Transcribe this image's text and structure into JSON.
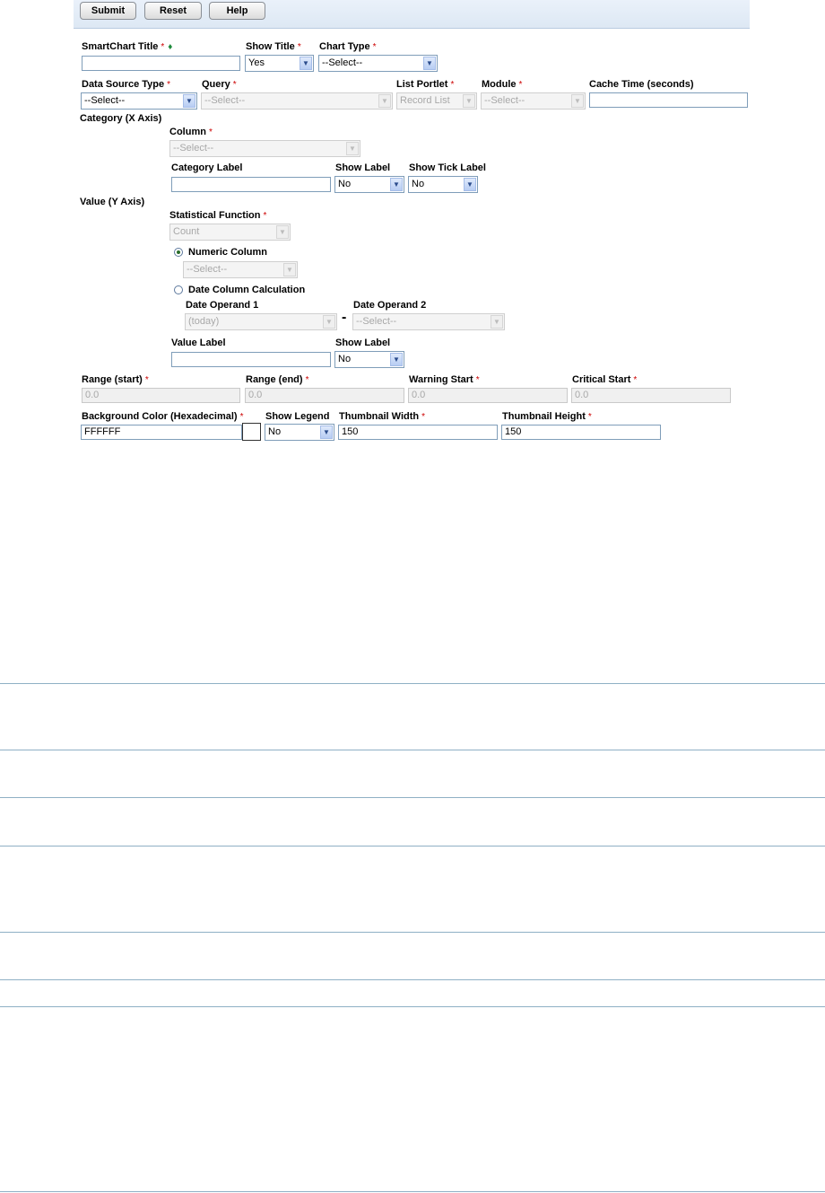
{
  "toolbar": {
    "submit_label": "Submit",
    "reset_label": "Reset",
    "help_label": "Help"
  },
  "required_mark": "*",
  "sections": {
    "category": "Category (X Axis)",
    "value": "Value (Y Axis)"
  },
  "fields": {
    "smartchart_title": {
      "label": "SmartChart Title",
      "value": ""
    },
    "show_title": {
      "label": "Show Title",
      "value": "Yes"
    },
    "chart_type": {
      "label": "Chart Type",
      "value": "--Select--"
    },
    "data_source_type": {
      "label": "Data Source Type",
      "value": "--Select--"
    },
    "query": {
      "label": "Query",
      "value": "--Select--"
    },
    "list_portlet": {
      "label": "List Portlet",
      "value": "Record List"
    },
    "module": {
      "label": "Module",
      "value": "--Select--"
    },
    "cache_time": {
      "label": "Cache Time (seconds)",
      "value": ""
    },
    "column": {
      "label": "Column",
      "value": "--Select--"
    },
    "category_label": {
      "label": "Category Label",
      "value": ""
    },
    "category_show_label": {
      "label": "Show Label",
      "value": "No"
    },
    "show_tick_label": {
      "label": "Show Tick Label",
      "value": "No"
    },
    "statistical_function": {
      "label": "Statistical Function",
      "value": "Count"
    },
    "numeric_column": {
      "label": "Numeric Column",
      "value": "--Select--",
      "selected": true
    },
    "date_column_calculation": {
      "label": "Date Column Calculation",
      "selected": false
    },
    "date_operand_1": {
      "label": "Date Operand 1",
      "value": "(today)"
    },
    "date_operand_2": {
      "label": "Date Operand 2",
      "value": "--Select--"
    },
    "date_minus": "-",
    "value_label": {
      "label": "Value Label",
      "value": ""
    },
    "value_show_label": {
      "label": "Show Label",
      "value": "No"
    },
    "range_start": {
      "label": "Range (start)",
      "value": "0.0"
    },
    "range_end": {
      "label": "Range (end)",
      "value": "0.0"
    },
    "warning_start": {
      "label": "Warning Start",
      "value": "0.0"
    },
    "critical_start": {
      "label": "Critical Start",
      "value": "0.0"
    },
    "background_color": {
      "label": "Background Color (Hexadecimal)",
      "value": "FFFFFF",
      "swatch": "#FFFFFF"
    },
    "show_legend": {
      "label": "Show Legend",
      "value": "No"
    },
    "thumbnail_width": {
      "label": "Thumbnail Width",
      "value": "150"
    },
    "thumbnail_height": {
      "label": "Thumbnail Height",
      "value": "150"
    }
  },
  "colors": {
    "required": "#cc0000",
    "toolbar_bg": "#e3ecf7",
    "rule": "#8fb0c5"
  },
  "icons": {
    "dropdown": "chevron-down-icon",
    "title_marker": "diamond-icon"
  }
}
